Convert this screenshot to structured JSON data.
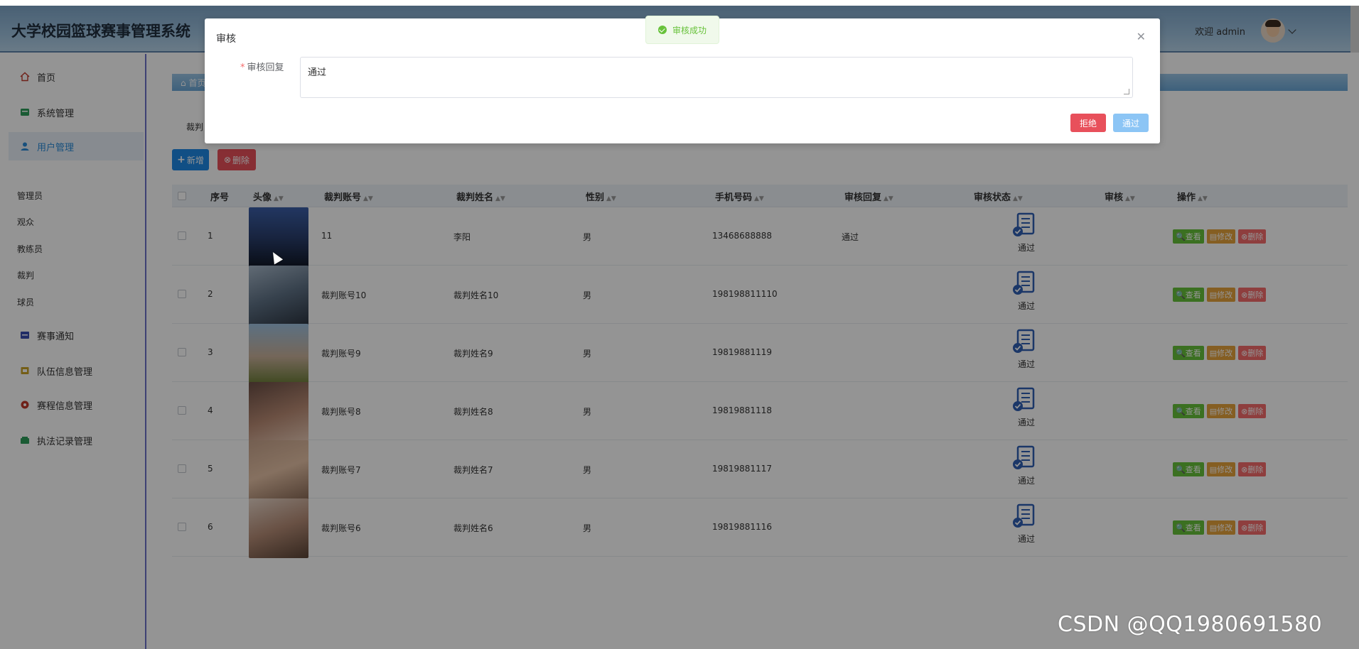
{
  "header": {
    "title": "大学校园篮球赛事管理系统",
    "welcome": "欢迎 admin"
  },
  "sidebar": {
    "items": [
      {
        "label": "首页",
        "icon": "home-icon"
      },
      {
        "label": "系统管理",
        "icon": "system-icon"
      },
      {
        "label": "用户管理",
        "icon": "user-icon"
      },
      {
        "label": "赛事通知",
        "icon": "notice-icon"
      },
      {
        "label": "队伍信息管理",
        "icon": "team-icon"
      },
      {
        "label": "赛程信息管理",
        "icon": "schedule-icon"
      },
      {
        "label": "执法记录管理",
        "icon": "record-icon"
      }
    ],
    "sub_items": [
      "管理员",
      "观众",
      "教练员",
      "裁判",
      "球员"
    ]
  },
  "main": {
    "breadcrumb": "首页",
    "tab_label": "裁判",
    "add_label": "新增",
    "delete_label": "删除",
    "columns": [
      "序号",
      "头像",
      "裁判账号",
      "裁判姓名",
      "性别",
      "手机号码",
      "审核回复",
      "审核状态",
      "审核",
      "操作"
    ],
    "rows": [
      {
        "idx": "1",
        "account": "11",
        "name": "李阳",
        "gender": "男",
        "phone": "13468688888",
        "reply": "通过",
        "status": "通过"
      },
      {
        "idx": "2",
        "account": "裁判账号10",
        "name": "裁判姓名10",
        "gender": "男",
        "phone": "198198811110",
        "reply": "",
        "status": "通过"
      },
      {
        "idx": "3",
        "account": "裁判账号9",
        "name": "裁判姓名9",
        "gender": "男",
        "phone": "19819881119",
        "reply": "",
        "status": "通过"
      },
      {
        "idx": "4",
        "account": "裁判账号8",
        "name": "裁判姓名8",
        "gender": "男",
        "phone": "19819881118",
        "reply": "",
        "status": "通过"
      },
      {
        "idx": "5",
        "account": "裁判账号7",
        "name": "裁判姓名7",
        "gender": "男",
        "phone": "19819881117",
        "reply": "",
        "status": "通过"
      },
      {
        "idx": "6",
        "account": "裁判账号6",
        "name": "裁判姓名6",
        "gender": "男",
        "phone": "19819881116",
        "reply": "",
        "status": "通过"
      }
    ],
    "ops": {
      "view": "查看",
      "edit": "修改",
      "remove": "删除"
    }
  },
  "dialog": {
    "title": "审核",
    "field_label": "审核回复",
    "reply_value": "通过",
    "reject_label": "拒绝",
    "pass_label": "通过"
  },
  "toast": {
    "text": "审核成功"
  },
  "watermark": "CSDN @QQ1980691580",
  "colors": {
    "primary": "#1e88e5",
    "danger": "#e8505b",
    "success": "#67c23a",
    "warning": "#e6a23c"
  }
}
